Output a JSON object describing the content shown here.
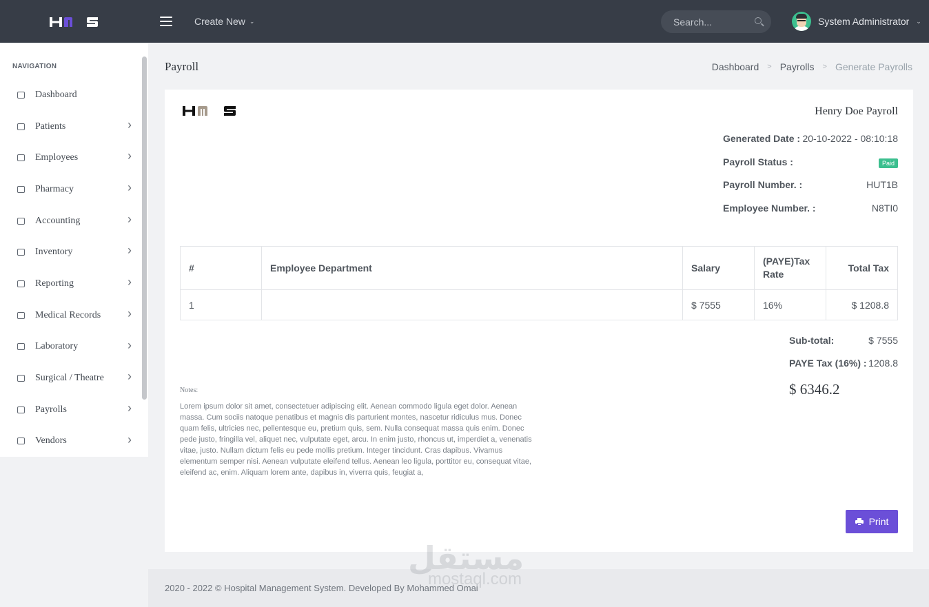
{
  "app": {
    "logo_text": "HMS",
    "brand_colors": {
      "topbar": "#373d47",
      "accent": "#6b4fd8",
      "success": "#3cbf8f"
    }
  },
  "topbar": {
    "create_new": "Create New",
    "search_placeholder": "Search...",
    "user_name": "System Administrator"
  },
  "sidebar": {
    "title": "NAVIGATION",
    "items": [
      {
        "label": "Dashboard",
        "icon": "monitor-icon",
        "has_children": false
      },
      {
        "label": "Patients",
        "icon": "wheelchair-icon",
        "has_children": true
      },
      {
        "label": "Employees",
        "icon": "user-tie-icon",
        "has_children": true
      },
      {
        "label": "Pharmacy",
        "icon": "pill-icon",
        "has_children": true
      },
      {
        "label": "Accounting",
        "icon": "money-icon",
        "has_children": true
      },
      {
        "label": "Inventory",
        "icon": "funnel-dollar-icon",
        "has_children": true
      },
      {
        "label": "Reporting",
        "icon": "upload-icon",
        "has_children": true
      },
      {
        "label": "Medical Records",
        "icon": "file-icon",
        "has_children": true
      },
      {
        "label": "Laboratory",
        "icon": "flask-icon",
        "has_children": true
      },
      {
        "label": "Surgical / Theatre",
        "icon": "procedure-icon",
        "has_children": true
      },
      {
        "label": "Payrolls",
        "icon": "briefcase-icon",
        "has_children": true
      },
      {
        "label": "Vendors",
        "icon": "users-icon",
        "has_children": true
      }
    ]
  },
  "page": {
    "title": "Payroll",
    "breadcrumb": [
      "Dashboard",
      "Payrolls",
      "Generate Payrolls"
    ]
  },
  "payroll": {
    "heading": "Henry Doe Payroll",
    "meta": [
      {
        "label": "Generated Date :",
        "value": "20-10-2022 - 08:10:18"
      },
      {
        "label": "Payroll Status :",
        "value": "Paid"
      },
      {
        "label": "Payroll Number. :",
        "value": "HUT1B"
      },
      {
        "label": "Employee Number. :",
        "value": "N8TI0"
      }
    ],
    "table": {
      "headers": [
        "#",
        "Employee Department",
        "Salary",
        "(PAYE)Tax Rate",
        "Total Tax"
      ],
      "rows": [
        [
          "1",
          "",
          "$ 7555",
          "16%",
          "$ 1208.8"
        ]
      ]
    },
    "totals": {
      "subtotal_label": "Sub-total:",
      "subtotal_value": "$ 7555",
      "tax_label": "PAYE Tax (16%) :",
      "tax_value": "1208.8",
      "grand_total": "$ 6346.2"
    },
    "notes_label": "Notes:",
    "notes": "Lorem ipsum dolor sit amet, consectetuer adipiscing elit. Aenean commodo ligula eget dolor. Aenean massa. Cum sociis natoque penatibus et magnis dis parturient montes, nascetur ridiculus mus. Donec quam felis, ultricies nec, pellentesque eu, pretium quis, sem. Nulla consequat massa quis enim. Donec pede justo, fringilla vel, aliquet nec, vulputate eget, arcu. In enim justo, rhoncus ut, imperdiet a, venenatis vitae, justo. Nullam dictum felis eu pede mollis pretium. Integer tincidunt. Cras dapibus. Vivamus elementum semper nisi. Aenean vulputate eleifend tellus. Aenean leo ligula, porttitor eu, consequat vitae, eleifend ac, enim. Aliquam lorem ante, dapibus in, viverra quis, feugiat a,",
    "print_label": "Print"
  },
  "footer": {
    "text": "2020 - 2022 © Hospital Management System. Developed By Mohammed Omai"
  },
  "watermark": {
    "arabic": "مستقل",
    "latin": "mostaql.com"
  }
}
